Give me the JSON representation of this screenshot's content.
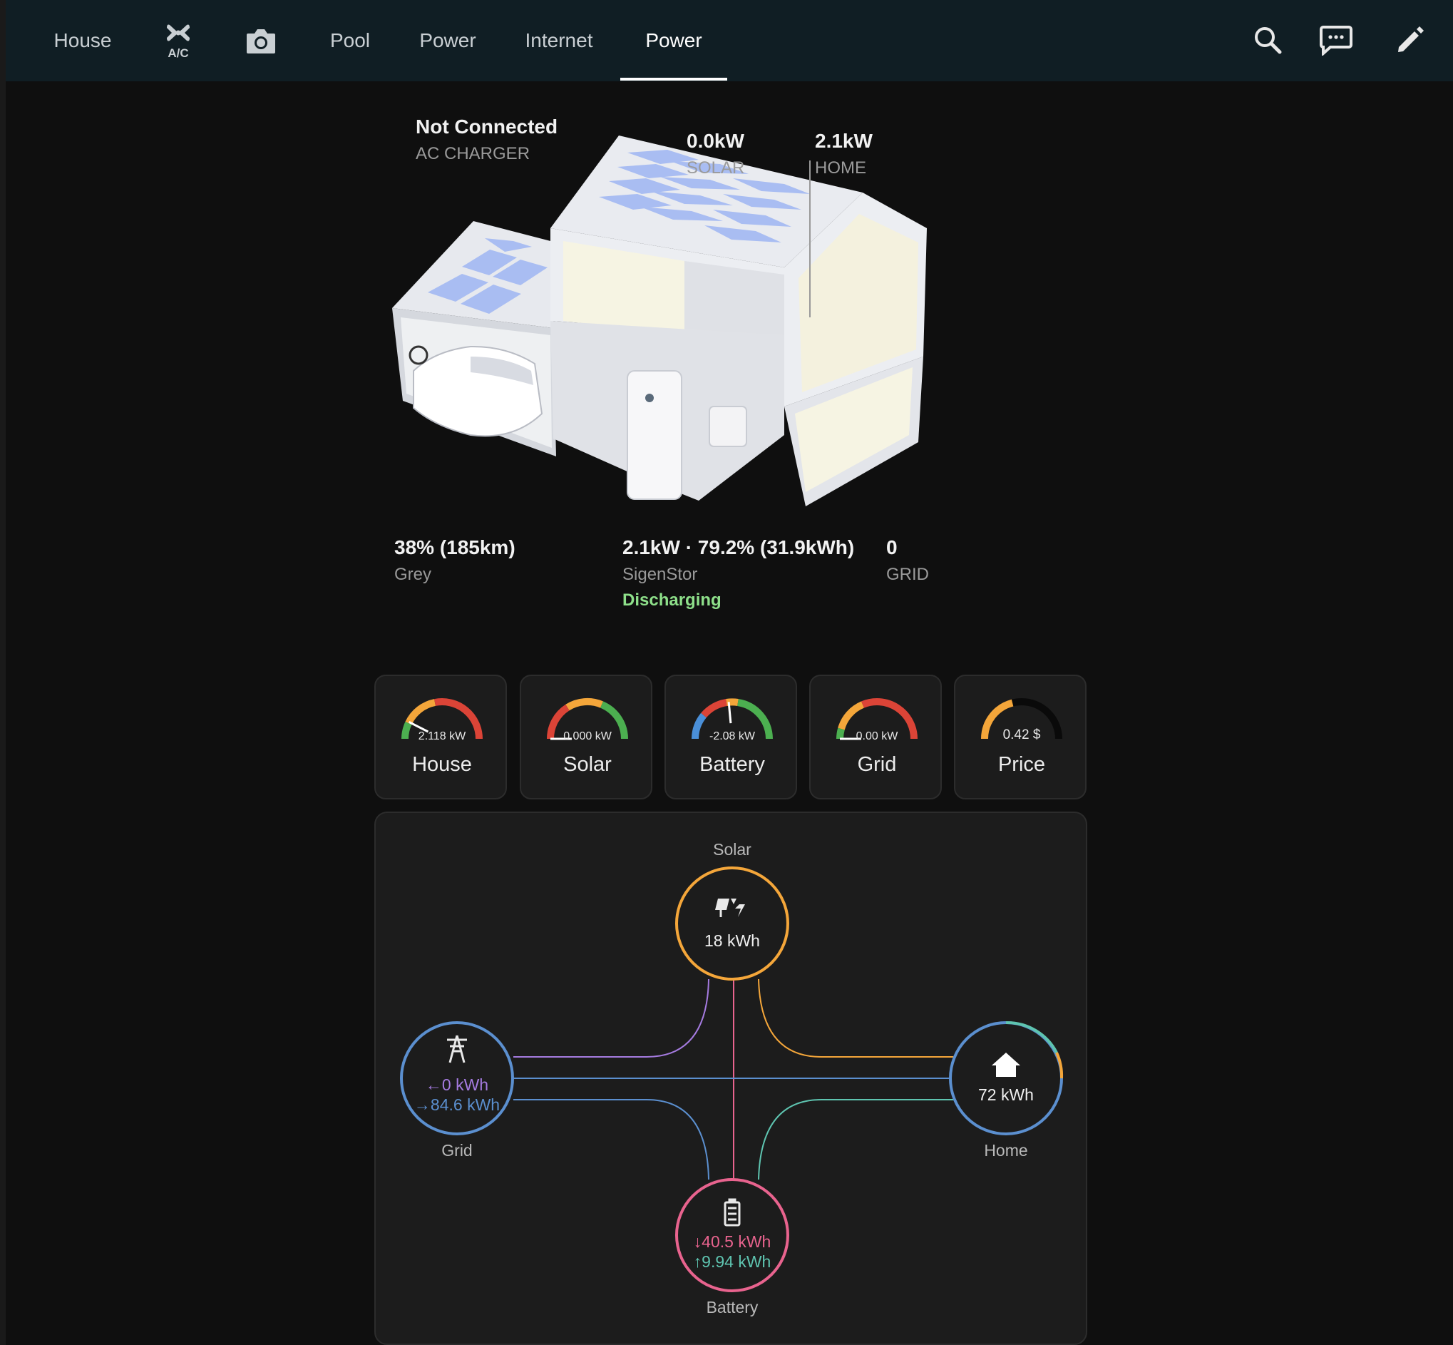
{
  "nav": {
    "tabs": [
      {
        "label": "House"
      },
      {
        "label": "A/C"
      },
      {
        "label": "Camera"
      },
      {
        "label": "Pool"
      },
      {
        "label": "Power"
      },
      {
        "label": "Internet"
      },
      {
        "label": "Power",
        "active": true
      }
    ],
    "actions": [
      "search-icon",
      "assist-icon",
      "edit-icon"
    ]
  },
  "house_overview": {
    "ac_charger": {
      "value": "Not Connected",
      "label": "AC CHARGER"
    },
    "solar": {
      "value": "0.0kW",
      "label": "SOLAR"
    },
    "home": {
      "value": "2.1kW",
      "label": "HOME"
    },
    "car": {
      "value": "38% (185km)",
      "label": "Grey"
    },
    "battery": {
      "value": "2.1kW · 79.2% (31.9kWh)",
      "label": "SigenStor",
      "status": "Discharging"
    },
    "grid": {
      "value": "0",
      "label": "GRID"
    }
  },
  "gauges": [
    {
      "name": "House",
      "value": "2.118 kW",
      "level": 0.15
    },
    {
      "name": "Solar",
      "value": "0.000 kW",
      "level": 0.0
    },
    {
      "name": "Battery",
      "value": "-2.08 kW",
      "level": 0.47
    },
    {
      "name": "Grid",
      "value": "0.00 kW",
      "level": 0.0
    },
    {
      "name": "Price",
      "value": "0.42 $",
      "level": 0.42
    }
  ],
  "energy_flow": {
    "solar": {
      "label": "Solar",
      "value": "18 kWh"
    },
    "grid": {
      "label": "Grid",
      "from": "0 kWh",
      "to": "84.6 kWh"
    },
    "home": {
      "label": "Home",
      "value": "72 kWh"
    },
    "battery": {
      "label": "Battery",
      "out": "40.5 kWh",
      "in": "9.94 kWh"
    },
    "colors": {
      "solar": "#f4a63a",
      "grid": "#5b8fcf",
      "grid_return": "#a57be0",
      "home": "#5b8fcf",
      "battery": "#e8638e",
      "battery_in": "#5ec4b0"
    }
  }
}
